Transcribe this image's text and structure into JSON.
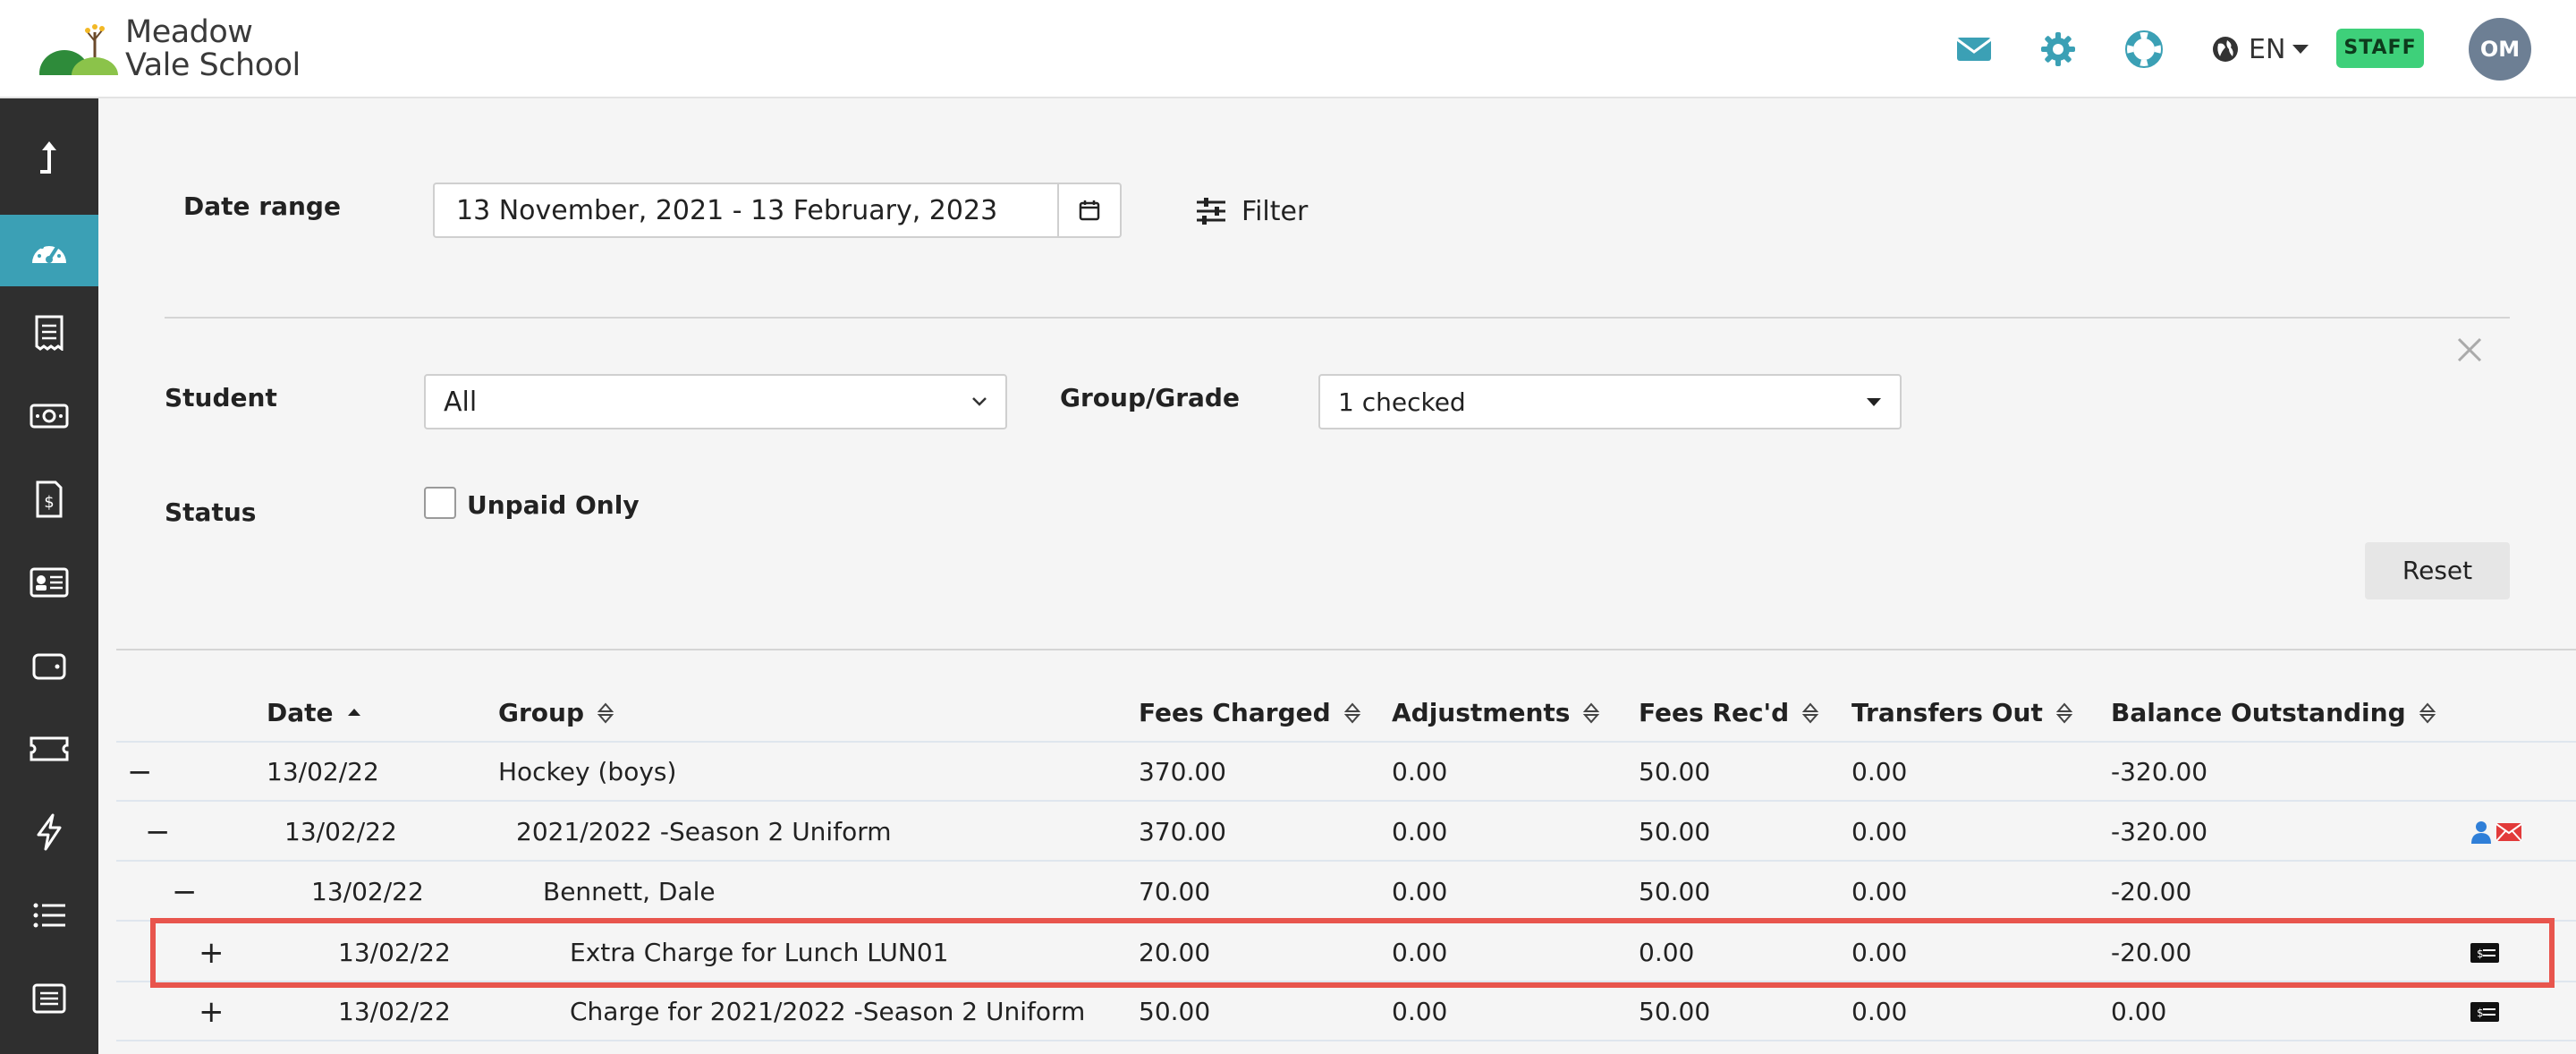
{
  "app": {
    "logo_line1": "Meadow",
    "logo_line2": "Vale School",
    "language": "EN",
    "staff_badge": "STAFF",
    "avatar_initials": "OM",
    "accent_color": "#3ba0b5",
    "icons": [
      "mail-icon",
      "gear-icon",
      "lifebuoy-icon",
      "globe-icon"
    ]
  },
  "sidebar": {
    "items": [
      {
        "name": "upload-icon",
        "active": false
      },
      {
        "name": "dashboard-icon",
        "active": true
      },
      {
        "name": "receipt-icon",
        "active": false
      },
      {
        "name": "cash-icon",
        "active": false
      },
      {
        "name": "invoice-icon",
        "active": false
      },
      {
        "name": "id-card-icon",
        "active": false
      },
      {
        "name": "wallet-icon",
        "active": false
      },
      {
        "name": "ticket-icon",
        "active": false
      },
      {
        "name": "lightning-icon",
        "active": false
      },
      {
        "name": "list-icon",
        "active": false
      },
      {
        "name": "report-icon",
        "active": false
      }
    ]
  },
  "filters": {
    "date_range_label": "Date range",
    "date_range_value": "13 November, 2021 - 13 February, 2023",
    "filter_label": "Filter",
    "student_label": "Student",
    "student_value": "All",
    "group_label": "Group/Grade",
    "group_value": "1 checked",
    "status_label": "Status",
    "unpaid_only_label": "Unpaid Only",
    "unpaid_only_checked": false,
    "reset_label": "Reset"
  },
  "table": {
    "columns": {
      "date": "Date",
      "group": "Group",
      "fees_charged": "Fees Charged",
      "adjustments": "Adjustments",
      "fees_recd": "Fees Rec'd",
      "transfers_out": "Transfers Out",
      "balance": "Balance Outstanding"
    },
    "rows": [
      {
        "toggle": "−",
        "date": "13/02/22",
        "group": "Hockey (boys)",
        "fees_charged": "370.00",
        "adjustments": "0.00",
        "fees_recd": "50.00",
        "transfers_out": "0.00",
        "balance": "-320.00"
      },
      {
        "toggle": "−",
        "date": "13/02/22",
        "group": "2021/2022 -Season 2 Uniform",
        "fees_charged": "370.00",
        "adjustments": "0.00",
        "fees_recd": "50.00",
        "transfers_out": "0.00",
        "balance": "-320.00"
      },
      {
        "toggle": "−",
        "date": "13/02/22",
        "group": "Bennett, Dale",
        "fees_charged": "70.00",
        "adjustments": "0.00",
        "fees_recd": "50.00",
        "transfers_out": "0.00",
        "balance": "-20.00"
      },
      {
        "toggle": "+",
        "date": "13/02/22",
        "group": "Extra Charge for Lunch LUN01",
        "fees_charged": "20.00",
        "adjustments": "0.00",
        "fees_recd": "0.00",
        "transfers_out": "0.00",
        "balance": "-20.00"
      },
      {
        "toggle": "+",
        "date": "13/02/22",
        "group": "Charge for 2021/2022 -Season 2 Uniform",
        "fees_charged": "50.00",
        "adjustments": "0.00",
        "fees_recd": "50.00",
        "transfers_out": "0.00",
        "balance": "0.00"
      }
    ]
  }
}
